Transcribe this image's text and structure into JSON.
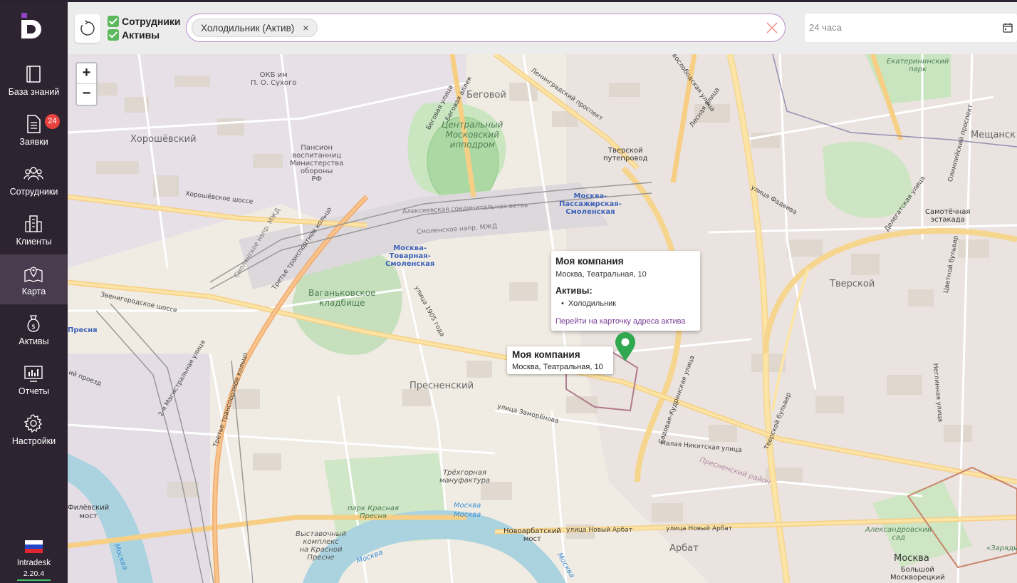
{
  "sidebar": {
    "logo": "Intradesk-logo",
    "items": [
      {
        "label": "База знаний",
        "icon": "book-icon"
      },
      {
        "label": "Заявки",
        "icon": "document-icon",
        "badge": "24"
      },
      {
        "label": "Сотрудники",
        "icon": "users-icon"
      },
      {
        "label": "Клиенты",
        "icon": "building-icon"
      },
      {
        "label": "Карта",
        "icon": "map-icon",
        "active": true
      },
      {
        "label": "Активы",
        "icon": "money-bag-icon"
      },
      {
        "label": "Отчеты",
        "icon": "chart-icon"
      },
      {
        "label": "Настройки",
        "icon": "gear-icon"
      }
    ],
    "footer": {
      "app_name": "Intradesk",
      "version": "2.20.4",
      "flag": "ru-flag"
    }
  },
  "toolbar": {
    "refresh_icon": "refresh-icon",
    "filters": [
      {
        "label": "Сотрудники",
        "checked": true
      },
      {
        "label": "Активы",
        "checked": true
      }
    ],
    "search": {
      "chip": "Холодильник (Актив)",
      "chip_remove": "×",
      "clear_icon": "clear-icon"
    },
    "period": {
      "value": "24 часа",
      "icon": "calendar-icon"
    }
  },
  "map": {
    "zoom_in": "+",
    "zoom_out": "−",
    "popup": {
      "title": "Моя компания",
      "address": "Москва, Театральная, 10",
      "assets_heading": "Активы:",
      "assets": [
        "Холодильник"
      ],
      "link": "Перейти на карточку адреса актива"
    },
    "tooltip": {
      "title": "Моя компания",
      "address": "Москва, Театральная, 10"
    },
    "marker_icon": "map-pin-icon",
    "labels": {
      "okb": "ОКБ им\nП. О. Сухого",
      "begovoy": "Беговой",
      "khoroshevsky": "Хорошёвский",
      "pansion": "Пансион\nвоспитанниц\nМинистерства\nобороны\nРФ",
      "hippodrome": "Центральный\nМосковский\nипподром",
      "tverskoy_put": "Тверской\nпутепровод",
      "pass_smol": "Москва-\nПассажирская-\nСмоленская",
      "tov_smol": "Москва-\nТоварная-\nСмоленская",
      "vagankovo": "Ваганьковское\nкладбище",
      "presnensky": "Пресненский",
      "tverskoy": "Тверской",
      "meshchansky": "Мещанск",
      "samotechnaya": "Самотёчная\nэстакада",
      "ekaterininsky": "Екатерининский\nпарк",
      "presnya": "Пресня",
      "trekhgornaya": "Трёхгорная\nмануфактура",
      "krasnaya_presnya": "парк Красная\nПресня",
      "vystavochny": "Выставочный\nкомплекс\nна Красной\nПресне",
      "novoarbatsky": "Новоарбатский\nмост",
      "arbat": "Арбат",
      "moskva": "Москва",
      "bolshoy_most": "Большой\nМоскворецкий",
      "alexandrovsky": "Александровский\nсад",
      "zarya": "«Зарядье»",
      "filevsky": "Филёвский\nмост",
      "presnensky_rayon": "Пресненский район",
      "moskva_river1": "Москва",
      "moskva_river2": "Москва",
      "moskva_river3": "Москва",
      "moskva_river4": "Москва",
      "moskva_river5": "Москва",
      "khoroshevskoe": "Хорошёвское шоссе",
      "zvenigorodskoe": "Звенигородское шоссе",
      "leningradsky": "Ленинградский проспект",
      "begovaya": "Беговая улица",
      "begovaya_alleya": "Беговая аллея",
      "zamorenova": "улица Заморёнова",
      "malaya_nikitskaya": "Малая Никитская улица",
      "novy_arbat": "улица Новый Арбат",
      "novy_arbat2": "улица Новый Арбат",
      "fadeeva": "улица Фадеева",
      "ulitsa_1905": "улица 1905 года",
      "sadovaya_kudrinskaya": "Садовая-Кудринская улица",
      "tverskoy_bulvar": "Тверской бульвар",
      "tsvetnoy": "Цветной бульвар",
      "olimpiysky": "Олимпийский проспект",
      "delegatskaya": "Делегатская улица",
      "neglinnaya": "Неглинная улица",
      "lesnaya": "Лесная улица",
      "novoslobodskaya": "Новослободская улица",
      "ttk1": "Третье транспортное кольцо",
      "ttk2": "Третье транспортное кольцо",
      "magistralnaya": "2-я Магистральная улица",
      "aleks_vetki": "Алексеевская соединительная ветвь",
      "smol_napr": "Смоленское напр. МЖД",
      "smol_napr2": "Смоленское напр. МЖД",
      "vtoroy_proezd": "ий проезд"
    }
  }
}
